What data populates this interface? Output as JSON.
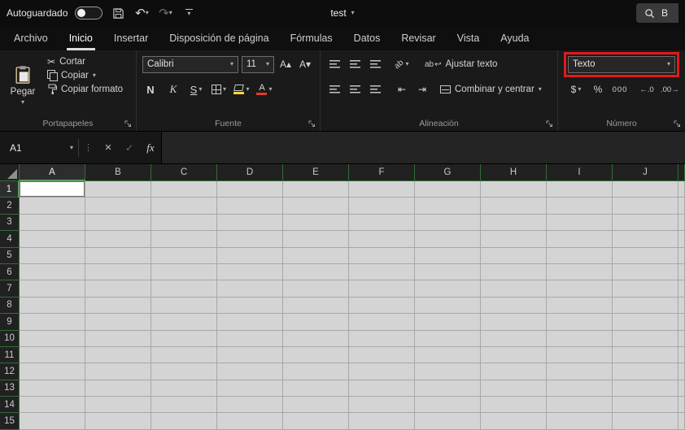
{
  "window": {
    "titlebar": {
      "autosave_label": "Autoguardado",
      "autosave_state": "off",
      "document_title": "test",
      "search_text": "B"
    }
  },
  "tabs": {
    "items": [
      "Archivo",
      "Inicio",
      "Insertar",
      "Disposición de página",
      "Fórmulas",
      "Datos",
      "Revisar",
      "Vista",
      "Ayuda"
    ],
    "active": "Inicio"
  },
  "ribbon": {
    "clipboard": {
      "group_label": "Portapapeles",
      "paste_label": "Pegar",
      "cut_label": "Cortar",
      "copy_label": "Copiar",
      "format_painter_label": "Copiar formato"
    },
    "font": {
      "group_label": "Fuente",
      "font_name": "Calibri",
      "font_size": "11",
      "increase_font_glyph": "A▴",
      "decrease_font_glyph": "A▾",
      "bold_label": "N",
      "italic_label": "K",
      "underline_label": "S"
    },
    "alignment": {
      "group_label": "Alineación",
      "wrap_icon_text": "ab",
      "wrap_text_label": "Ajustar texto",
      "orientation_icon_text": "ab",
      "merge_center_label": "Combinar y centrar"
    },
    "number": {
      "group_label": "Número",
      "format_value": "Texto",
      "currency_label": "$",
      "percent_label": "%",
      "thousands_label": "000",
      "increase_decimal_glyph": "←.0",
      "decrease_decimal_glyph": ".00→"
    }
  },
  "formula_bar": {
    "name_box_value": "A1",
    "fx_label": "fx"
  },
  "grid": {
    "columns": [
      "A",
      "B",
      "C",
      "D",
      "E",
      "F",
      "G",
      "H",
      "I",
      "J"
    ],
    "rows": [
      "1",
      "2",
      "3",
      "4",
      "5",
      "6",
      "7",
      "8",
      "9",
      "10",
      "11",
      "12",
      "13",
      "14",
      "15"
    ],
    "selected_cell": "A1",
    "selected_column": "A",
    "selected_row": "1"
  },
  "icons": {
    "dropdown": "▾",
    "undo": "↶",
    "redo": "↷",
    "scissors": "✂",
    "dots": "⋮",
    "cancel": "×",
    "enter": "✓",
    "wrap_return": "↩",
    "indent_decrease": "⇤",
    "indent_increase": "⇥"
  },
  "colors": {
    "highlight_red": "#e21a1a",
    "header_border_green": "#356b35",
    "tab_underline": "#dcdcdc",
    "fill_yellow": "#ffd43a",
    "font_color_red": "#e03c31",
    "excel_green": "#217346"
  }
}
